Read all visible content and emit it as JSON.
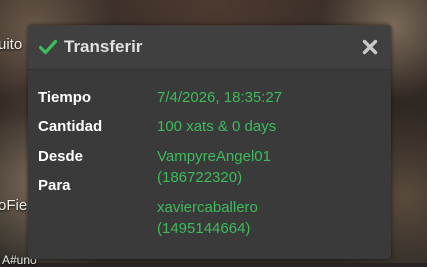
{
  "background": {
    "text_top": "uito",
    "text_mid": "oFie",
    "text_bottom": "A#uno"
  },
  "dialog": {
    "title": "Transferir",
    "accent_color": "#3cbc5c",
    "fields": {
      "tiempo_label": "Tiempo",
      "tiempo_value": "7/4/2026, 18:35:27",
      "cantidad_label": "Cantidad",
      "cantidad_value": "100 xats & 0 days",
      "desde_label": "Desde",
      "desde_name": "VampyreAngel01",
      "desde_id": "(186722320)",
      "para_label": "Para",
      "para_name": "xaviercaballero",
      "para_id": "(1495144664)"
    }
  }
}
